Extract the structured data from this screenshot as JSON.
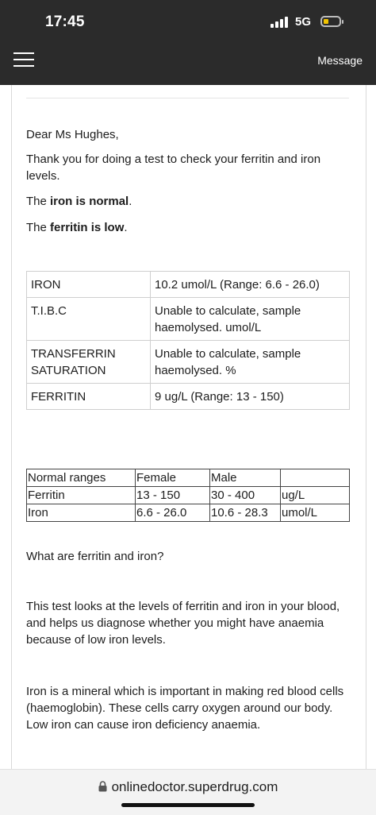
{
  "status_bar": {
    "time": "17:45",
    "network": "5G"
  },
  "app_bar": {
    "menu_icon": "hamburger-menu-icon",
    "message_label": "Message"
  },
  "letter": {
    "greeting": "Dear Ms Hughes,",
    "intro": "Thank you for doing a test to check your ferritin and iron levels.",
    "iron_prefix": "The ",
    "iron_bold": "iron is normal",
    "iron_suffix": ".",
    "ferritin_prefix": "The ",
    "ferritin_bold": "ferritin is low",
    "ferritin_suffix": "."
  },
  "results": [
    {
      "label": "IRON",
      "value": "10.2 umol/L (Range: 6.6 - 26.0)"
    },
    {
      "label": "T.I.B.C",
      "value": "Unable to calculate, sample haemolysed. umol/L"
    },
    {
      "label": "TRANSFERRIN SATURATION",
      "value": "Unable to calculate, sample haemolysed. %"
    },
    {
      "label": "FERRITIN",
      "value": "9 ug/L (Range: 13 - 150)"
    }
  ],
  "ranges": {
    "headers": [
      "Normal ranges",
      "Female",
      "Male",
      ""
    ],
    "rows": [
      [
        "Ferritin",
        "13 - 150",
        "30 - 400",
        "ug/L"
      ],
      [
        "Iron",
        "6.6 - 26.0",
        "10.6 - 28.3",
        "umol/L"
      ]
    ]
  },
  "info": {
    "question": "What are ferritin and iron?",
    "para1": "This test looks at the levels of ferritin and iron in your blood, and helps us diagnose whether you might have anaemia because of low iron levels.",
    "para2": "Iron is a mineral which is important in making red blood cells (haemoglobin). These cells carry oxygen around our body. Low iron can cause iron deficiency anaemia."
  },
  "browser": {
    "url": "onlinedoctor.superdrug.com",
    "lock_icon": "lock-icon"
  },
  "colors": {
    "top_bar": "#2b2b2b",
    "battery": "#f2c400"
  }
}
